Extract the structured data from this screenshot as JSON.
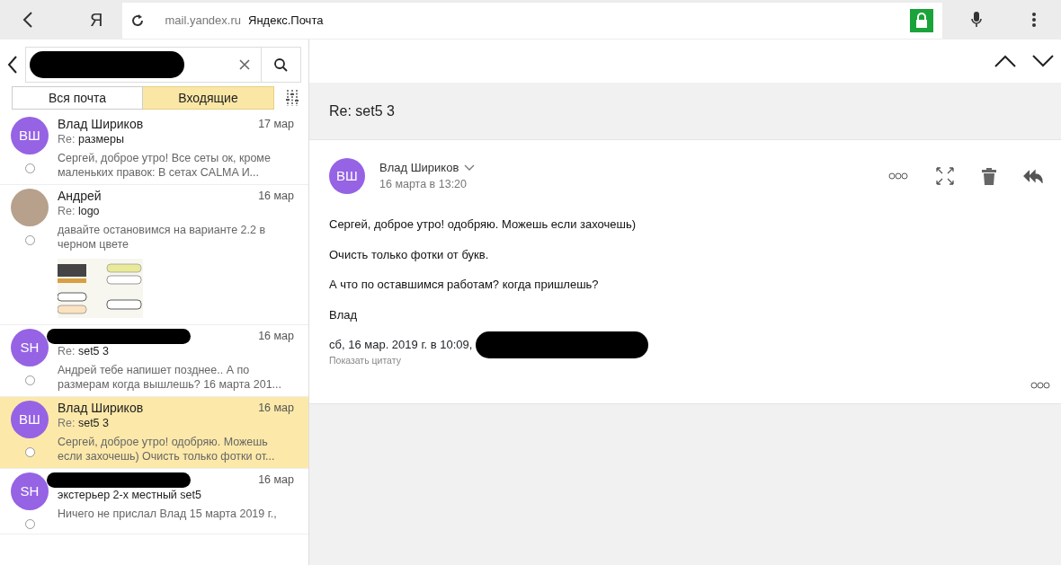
{
  "browser": {
    "logo": "Я",
    "url": "mail.yandex.ru",
    "page_title": "Яндекс.Почта",
    "secure": true
  },
  "search": {
    "redacted": true
  },
  "tabs": [
    {
      "label": "Вся почта",
      "selected": false
    },
    {
      "label": "Входящие",
      "selected": true
    }
  ],
  "messages": [
    {
      "kind": "initials",
      "initials": "ВШ",
      "sender": "Влад Шириков",
      "date": "17 мар",
      "subject_prefix": "Re:",
      "subject": "размеры",
      "preview": "Сергей, доброе утро! Все сеты ок, кроме маленьких правок: В сетах CALMA И...",
      "read": false,
      "selected": false
    },
    {
      "kind": "photo",
      "sender": "Андрей",
      "date": "16 мар",
      "subject_prefix": "Re:",
      "subject": "logo",
      "preview": "давайте остановимся на варианте 2.2 в черном цвете",
      "read": false,
      "selected": false,
      "attachments": true
    },
    {
      "kind": "initials",
      "initials": "SH",
      "sender_redacted": true,
      "date": "16 мар",
      "subject_prefix": "Re:",
      "subject": "set5 3",
      "preview": "Андрей тебе напишет позднее.. А по размерам когда вышлешь? 16 марта 201...",
      "read": false,
      "selected": false
    },
    {
      "kind": "initials",
      "initials": "ВШ",
      "sender": "Влад Шириков",
      "date": "16 мар",
      "subject_prefix": "Re:",
      "subject": "set5 3",
      "preview": "Сергей, доброе утро! одобряю. Можешь если захочешь) Очисть только фотки от...",
      "read": false,
      "selected": true
    },
    {
      "kind": "initials",
      "initials": "SH",
      "sender_redacted": true,
      "date": "16 мар",
      "subject": "экстерьер 2-х местный set5",
      "preview": "Ничего не прислал Влад 15 марта 2019 г.,",
      "read": false,
      "selected": false
    }
  ],
  "reader": {
    "subject": "Re: set5 3",
    "initials": "ВШ",
    "sender": "Влад Шириков",
    "date": "16 марта в 13:20",
    "body": [
      "Сергей, доброе утро! одобряю. Можешь если захочешь)",
      "Очисть только фотки от букв.",
      "А что по оставшимся работам? когда пришлешь?",
      "Влад"
    ],
    "quote_header": "сб, 16 мар. 2019 г. в 10:09,",
    "quote_author_redacted": true,
    "show_quote": "Показать цитату"
  }
}
